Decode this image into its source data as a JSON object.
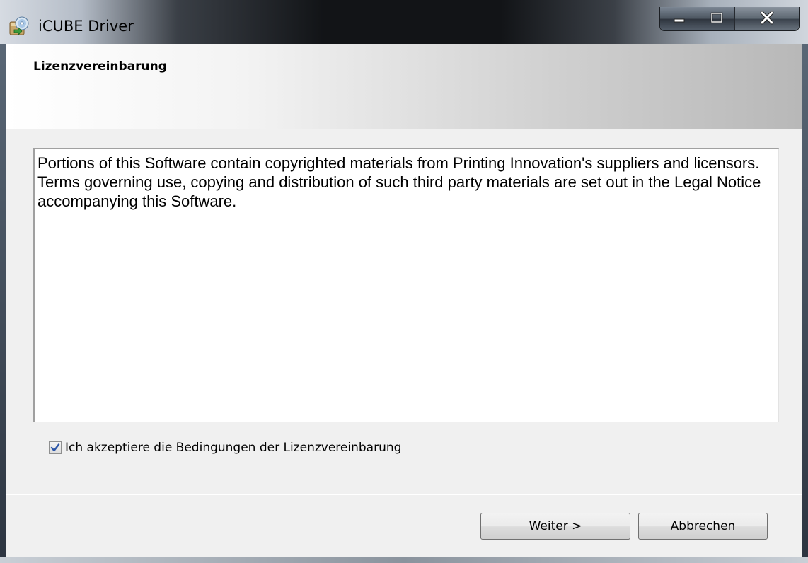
{
  "window": {
    "title": "iCUBE Driver",
    "app_icon": "installer-cd-icon",
    "caption_buttons": {
      "minimize_icon": "minimize-icon",
      "maximize_icon": "maximize-icon",
      "close_icon": "close-icon"
    }
  },
  "header": {
    "title": "Lizenzvereinbarung"
  },
  "license": {
    "text": "Portions of this Software contain copyrighted materials from Printing Innovation's suppliers and licensors. Terms governing use, copying and distribution of such third party materials are set out in the Legal Notice accompanying this Software."
  },
  "accept_checkbox": {
    "label": "Ich akzeptiere die Bedingungen der Lizenzvereinbarung",
    "checked": true
  },
  "buttons": {
    "next_label": "Weiter >",
    "cancel_label": "Abbrechen"
  },
  "colors": {
    "checkmark": "#2b55a8",
    "title_bar_dark": "#121417"
  }
}
